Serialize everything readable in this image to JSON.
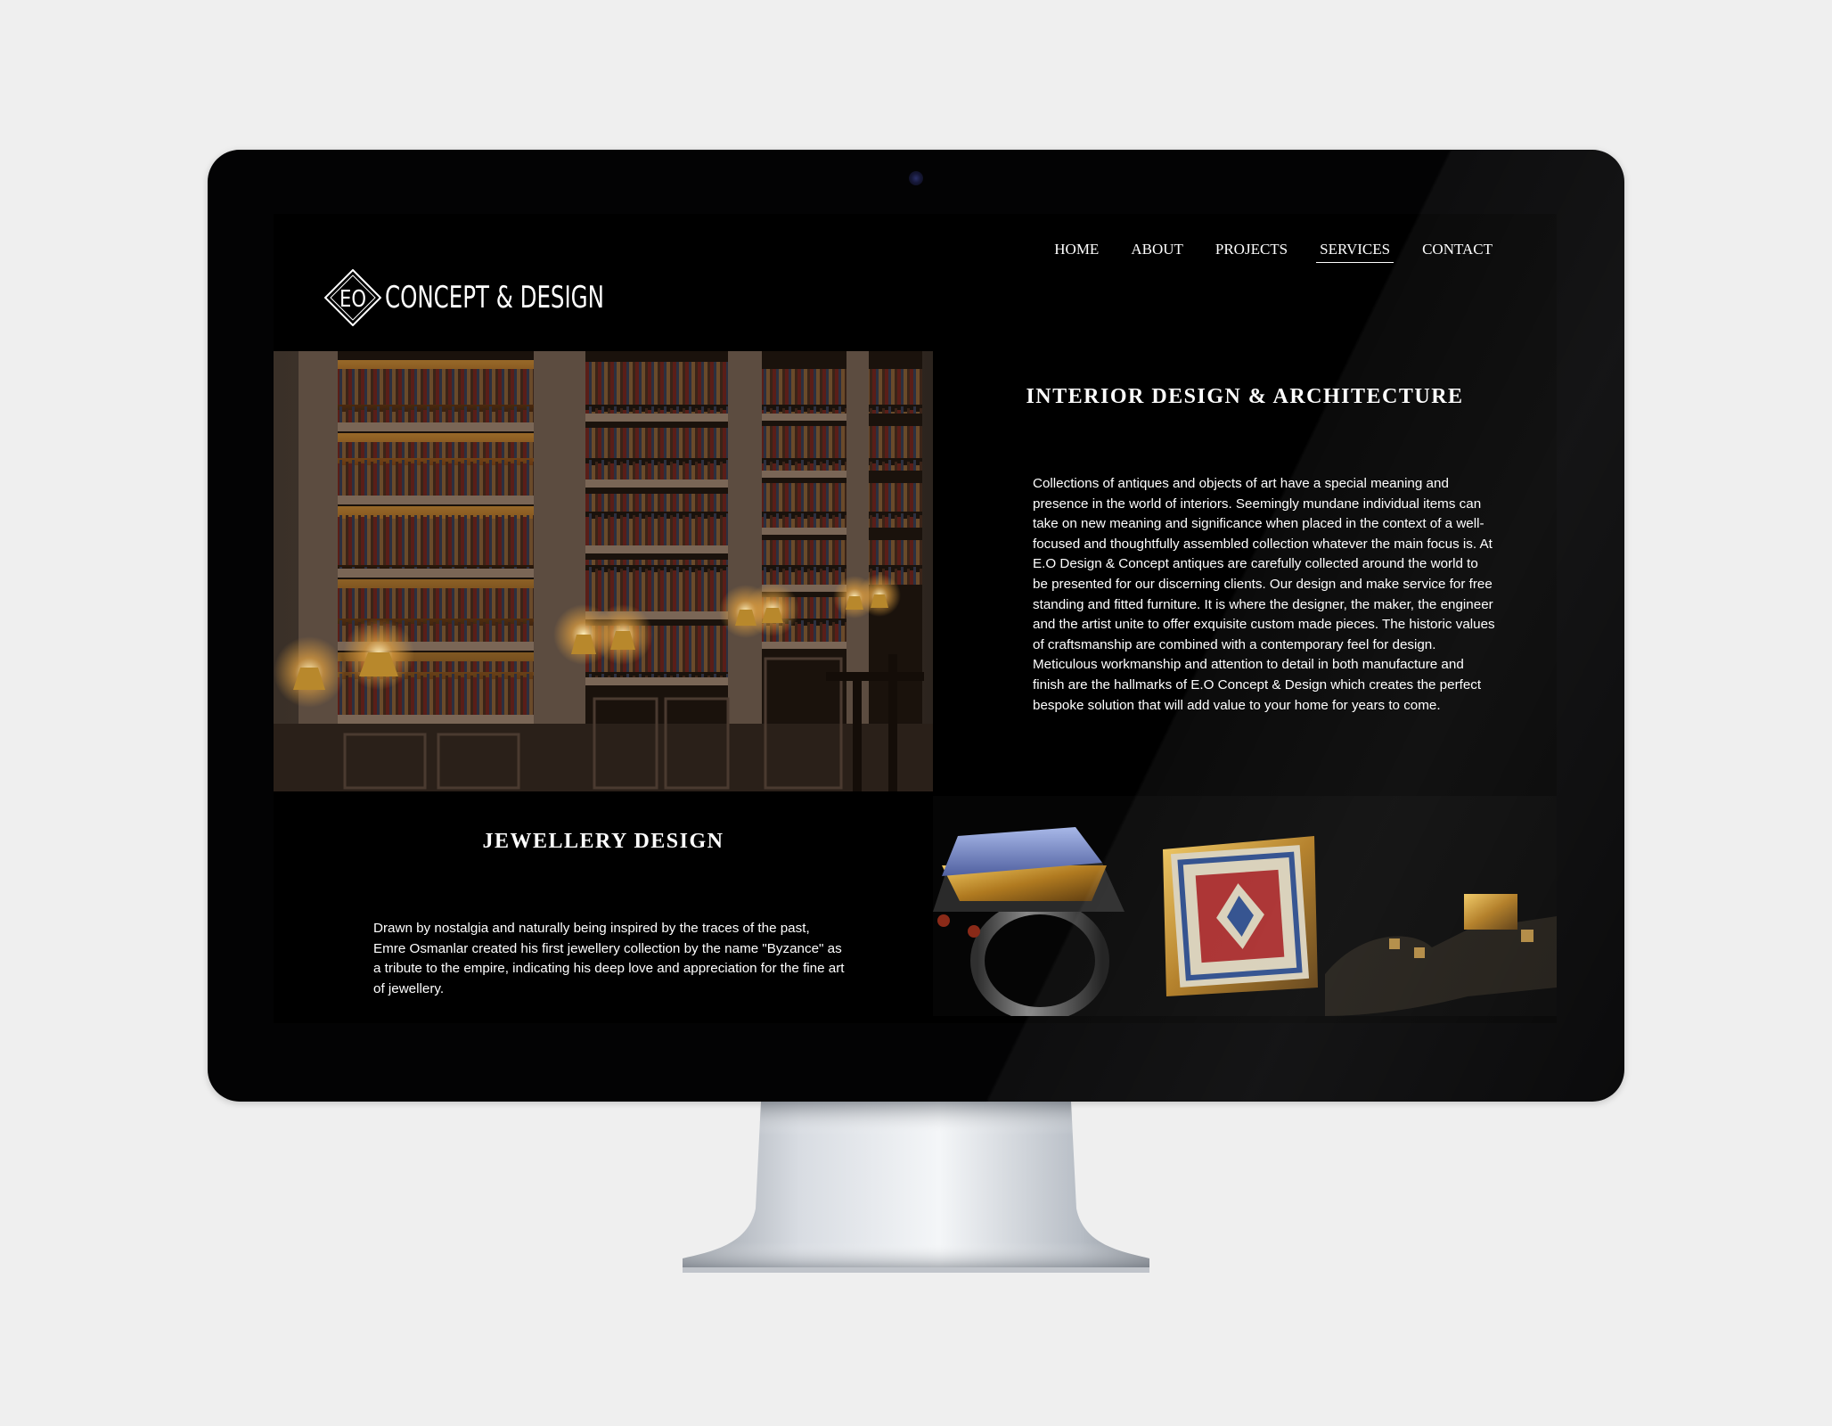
{
  "site": {
    "logo": {
      "monogram": "EO",
      "name": "CONCEPT & DESIGN"
    },
    "nav": {
      "items": [
        {
          "label": "HOME",
          "active": false
        },
        {
          "label": "ABOUT",
          "active": false
        },
        {
          "label": "PROJECTS",
          "active": false
        },
        {
          "label": "SERVICES",
          "active": true
        },
        {
          "label": "CONTACT",
          "active": false
        }
      ]
    },
    "sections": {
      "interior": {
        "title": "INTERIOR DESIGN & ARCHITECTURE",
        "body": "Collections of antiques and objects of art have a special meaning and presence in the world of interiors. Seemingly mundane individual items can take on new meaning and significance when placed in the context of a well-focused and thoughtfully assembled collection whatever the main focus is. At E.O Design & Concept antiques are carefully collected around the world to be presented for our discerning clients. Our design and make service for free standing and fitted furniture. It is where the designer, the maker, the engineer and the artist unite to offer exquisite custom made pieces. The historic values of craftsmanship are combined with a contemporary feel for design. Meticulous workmanship and attention to detail in both manufacture and finish are the hallmarks of E.O Concept & Design which creates the perfect bespoke solution that will add value to your home for years to come."
      },
      "jewellery": {
        "title": "JEWELLERY DESIGN",
        "body": "Drawn by nostalgia and naturally being inspired by the traces of the past, Emre Osmanlar created his first jewellery collection by the name \"Byzance\" as a tribute to the empire, indicating his deep love and appreciation for the fine art of jewellery."
      }
    }
  },
  "colors": {
    "page_bg": "#efefef",
    "bezel": "#030304",
    "screen_bg": "#000000",
    "text": "#ffffff",
    "lamp_glow": "#f0a030"
  },
  "icons": {
    "logo_mark": "diamond-monogram-icon",
    "camera": "webcam-dot"
  }
}
